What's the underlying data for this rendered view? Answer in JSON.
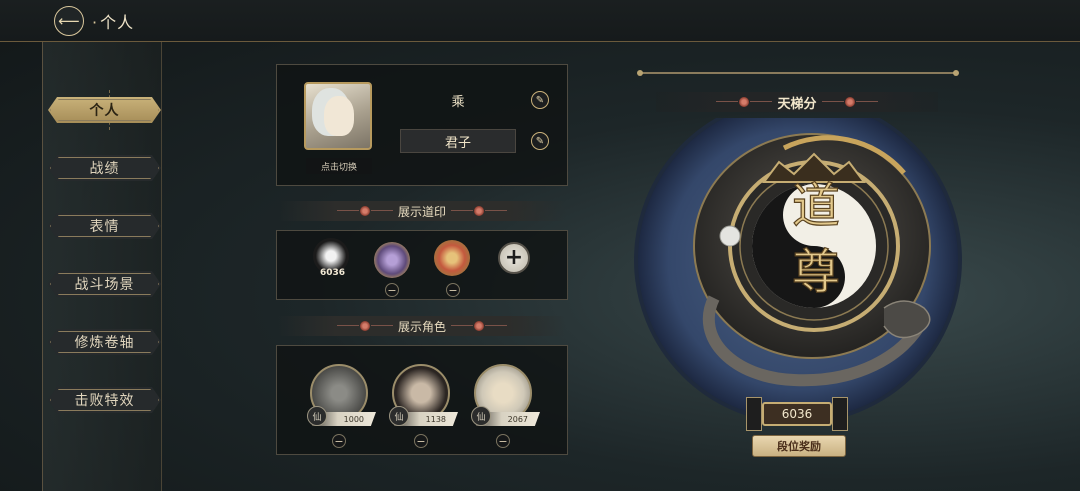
{
  "header": {
    "title": "个人",
    "back_icon": "back-arrow-icon"
  },
  "sidebar": {
    "items": [
      {
        "label": "个人",
        "active": true
      },
      {
        "label": "战绩",
        "active": false
      },
      {
        "label": "表情",
        "active": false
      },
      {
        "label": "战斗场景",
        "active": false
      },
      {
        "label": "修炼卷轴",
        "active": false
      },
      {
        "label": "击败特效",
        "active": false
      }
    ]
  },
  "profile": {
    "switch_label": "点击切换",
    "name": "乘",
    "title": "君子",
    "edit_icon": "pen-icon"
  },
  "seals": {
    "header": "展示道印",
    "items": [
      {
        "icon": "yin-yang-seal-icon",
        "value": "6036"
      },
      {
        "icon": "purple-seal-icon"
      },
      {
        "icon": "gold-seal-icon"
      }
    ],
    "add_icon": "plus-icon"
  },
  "characters": {
    "header": "展示角色",
    "items": [
      {
        "icon": "silhouette-character",
        "badge": "仙",
        "score": "1000"
      },
      {
        "icon": "dark-hair-character",
        "badge": "仙",
        "score": "1138"
      },
      {
        "icon": "white-hair-character",
        "badge": "仙",
        "score": "2067"
      }
    ]
  },
  "ladder": {
    "title": "天梯分",
    "rank_calligraphy": "道尊",
    "score": "6036",
    "rewards_button": "段位奖励"
  },
  "colors": {
    "accent_gold": "#c9b27a",
    "panel_bg": "#101314",
    "flower_red": "#d57c6a",
    "emblem_blue": "#3b4f6e"
  }
}
